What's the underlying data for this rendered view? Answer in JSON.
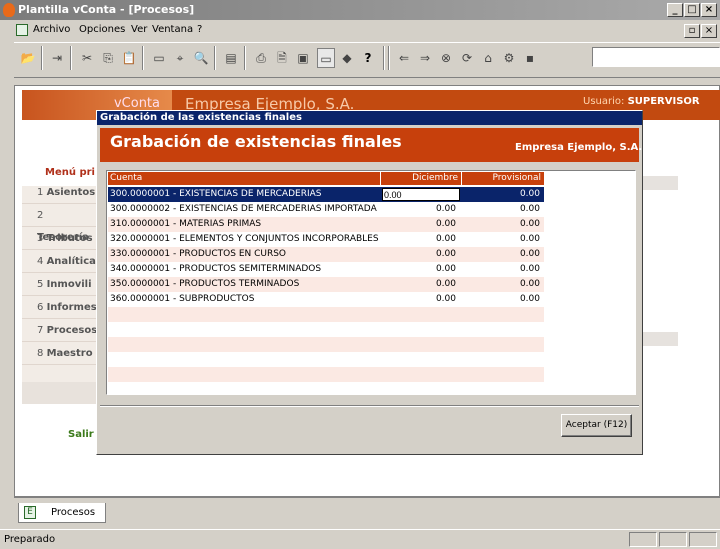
{
  "window": {
    "title": "Plantilla vConta - [Procesos]"
  },
  "menubar": {
    "items": [
      "Archivo",
      "Opciones",
      "Ver",
      "Ventana",
      "?"
    ]
  },
  "toolbar": {
    "search_value": ""
  },
  "app_header": {
    "logo": "vConta",
    "company": "Empresa Ejemplo, S.A.",
    "user_label": "Usuario:",
    "user_value": "SUPERVISOR"
  },
  "sidebar": {
    "menu_title": "Menú pri",
    "items": [
      {
        "num": "1",
        "label": "Asientos"
      },
      {
        "num": "2",
        "label": "Tesorería"
      },
      {
        "num": "3",
        "label": "Tributos"
      },
      {
        "num": "4",
        "label": "Analítica"
      },
      {
        "num": "5",
        "label": "Inmovili"
      },
      {
        "num": "6",
        "label": "Informes"
      },
      {
        "num": "7",
        "label": "Procesos"
      },
      {
        "num": "8",
        "label": "Maestro"
      }
    ],
    "exit": "Salir"
  },
  "dialog": {
    "title": "Grabación de las existencias finales",
    "banner_title": "Grabación de existencias finales",
    "banner_company": "Empresa Ejemplo, S.A.",
    "columns": {
      "cuenta": "Cuenta",
      "diciembre": "Diciembre",
      "provisional": "Provisional"
    },
    "rows": [
      {
        "cuenta": "300.0000001 - EXISTENCIAS DE MERCADERIAS",
        "diciembre": "0.00",
        "provisional": "0.00"
      },
      {
        "cuenta": "300.0000002 - EXISTENCIAS DE MERCADERIAS IMPORTADA",
        "diciembre": "0.00",
        "provisional": "0.00"
      },
      {
        "cuenta": "310.0000001 - MATERIAS PRIMAS",
        "diciembre": "0.00",
        "provisional": "0.00"
      },
      {
        "cuenta": "320.0000001 - ELEMENTOS Y CONJUNTOS INCORPORABLES",
        "diciembre": "0.00",
        "provisional": "0.00"
      },
      {
        "cuenta": "330.0000001 - PRODUCTOS EN CURSO",
        "diciembre": "0.00",
        "provisional": "0.00"
      },
      {
        "cuenta": "340.0000001 - PRODUCTOS SEMITERMINADOS",
        "diciembre": "0.00",
        "provisional": "0.00"
      },
      {
        "cuenta": "350.0000001 - PRODUCTOS TERMINADOS",
        "diciembre": "0.00",
        "provisional": "0.00"
      },
      {
        "cuenta": "360.0000001 - SUBPRODUCTOS",
        "diciembre": "0.00",
        "provisional": "0.00"
      }
    ],
    "accept_button": "Aceptar (F12)"
  },
  "tabs": {
    "active": "Procesos"
  },
  "status": {
    "text": "Preparado"
  }
}
